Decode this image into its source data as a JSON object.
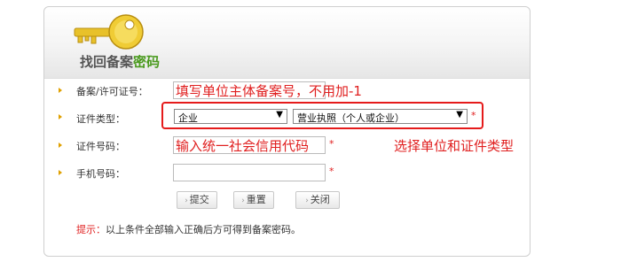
{
  "header": {
    "title_prefix": "找回备案",
    "title_highlight": "密码"
  },
  "form": {
    "record_label": "备案/许可证号：",
    "record_value": "填写单位主体备案号，不用加-1",
    "type_label": "证件类型：",
    "entity_select": "企业",
    "cert_select": "营业执照（个人或企业）",
    "id_label": "证件号码：",
    "id_value": "输入统一社会信用代码",
    "phone_label": "手机号码：",
    "required_mark": "*"
  },
  "annotations": {
    "select_hint": "选择单位和证件类型"
  },
  "buttons": {
    "submit": "提交",
    "reset": "重置",
    "close": "关闭",
    "chevron": "›"
  },
  "hint": {
    "prefix": "提示：",
    "text": "以上条件全部输入正确后方可得到备案密码。"
  },
  "colors": {
    "accent_green": "#4a9a1e",
    "annotation_red": "#e51b1b",
    "key_gold": "#e8c12a"
  }
}
